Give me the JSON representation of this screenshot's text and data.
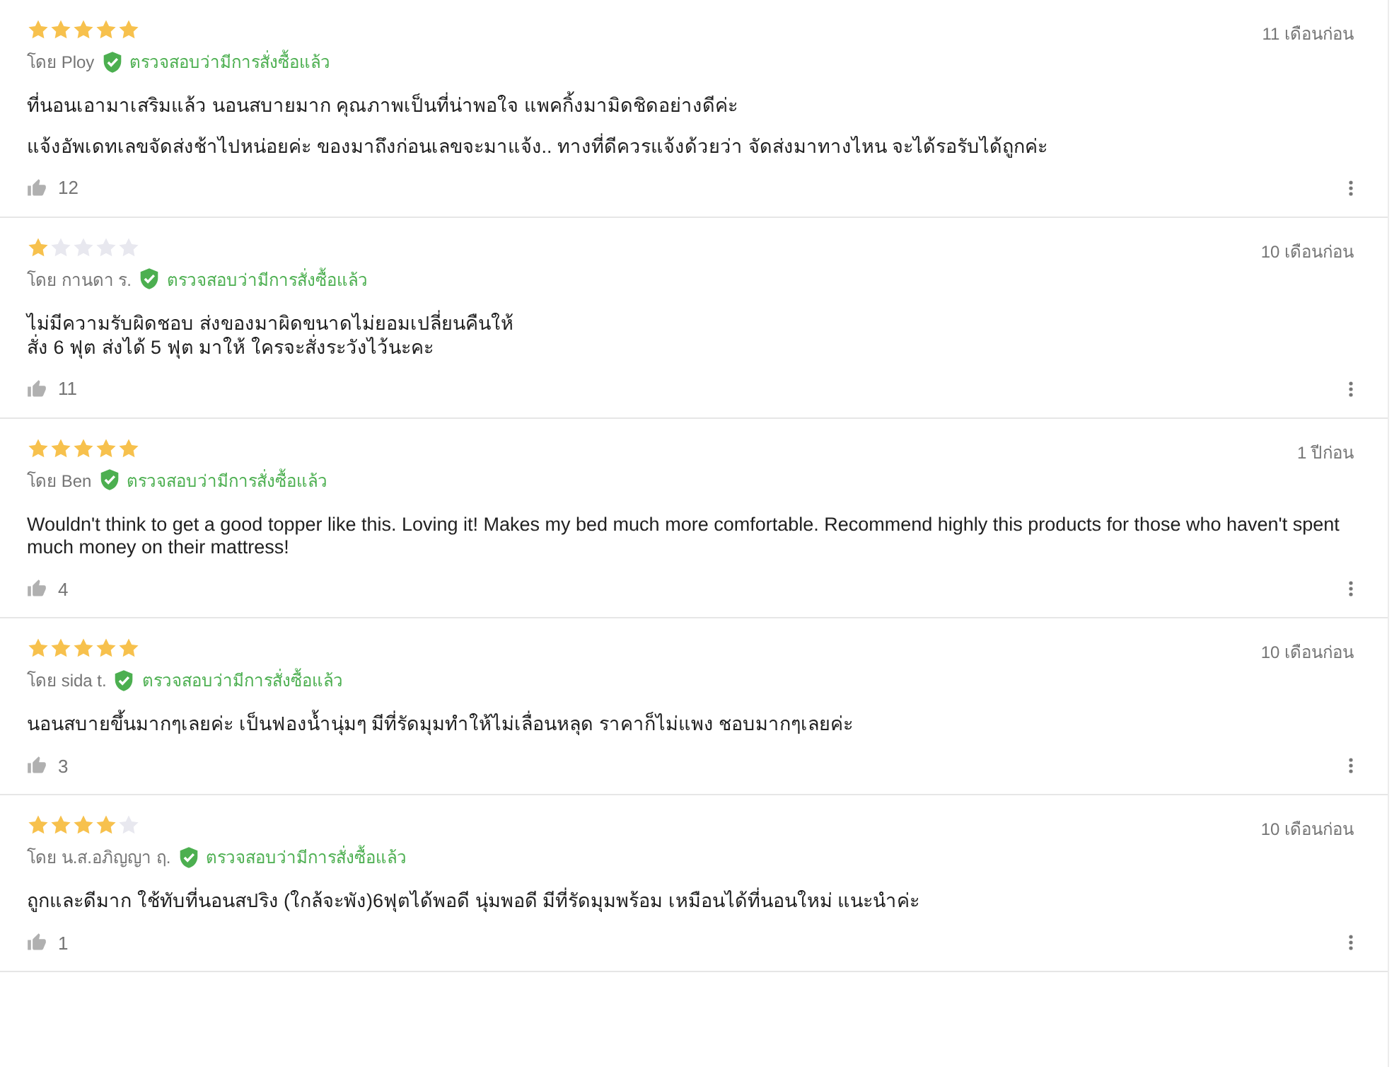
{
  "reviews": [
    {
      "stars": 5,
      "author": "โดย Ploy",
      "verified": "ตรวจสอบว่ามีการสั่งซื้อแล้ว",
      "date": "11 เดือนก่อน",
      "paragraphs": [
        "ที่นอนเอามาเสริมแล้ว นอนสบายมาก  คุณภาพเป็นที่น่าพอใจ แพคกิ้งมามิดชิดอย่างดีค่ะ",
        "แจ้งอัพเดทเลขจัดส่งช้าไปหน่อยค่ะ ของมาถึงก่อนเลขจะมาแจ้ง.. ทางที่ดีควรแจ้งด้วยว่า จัดส่งมาทางไหน จะได้รอรับได้ถูกค่ะ"
      ],
      "likes": "12"
    },
    {
      "stars": 1,
      "author": "โดย กานดา ร.",
      "verified": "ตรวจสอบว่ามีการสั่งซื้อแล้ว",
      "date": "10 เดือนก่อน",
      "paragraphs": [
        "ไม่มีความรับผิดชอบ ส่งของมาผิดขนาดไม่ยอมเปลี่ยนคืนให้\nสั่ง 6 ฟุต ส่งได้ 5 ฟุต มาให้ ใครจะสั่งระวังไว้นะคะ"
      ],
      "likes": "11"
    },
    {
      "stars": 5,
      "author": "โดย Ben",
      "verified": "ตรวจสอบว่ามีการสั่งซื้อแล้ว",
      "date": "1 ปีก่อน",
      "paragraphs": [
        "Wouldn't think to get a good topper like this. Loving it! Makes my bed much more comfortable. Recommend highly this products for those who haven't spent much money on their mattress!"
      ],
      "likes": "4"
    },
    {
      "stars": 5,
      "author": "โดย sida t.",
      "verified": "ตรวจสอบว่ามีการสั่งซื้อแล้ว",
      "date": "10 เดือนก่อน",
      "paragraphs": [
        "นอนสบายขึ้นมากๆเลยค่ะ เป็นฟองน้ำนุ่มๆ มีที่รัดมุมทำให้ไม่เลื่อนหลุด  ราคาก็ไม่แพง  ชอบมากๆเลยค่ะ"
      ],
      "likes": "3"
    },
    {
      "stars": 4,
      "author": "โดย น.ส.อภิญญา ฤ.",
      "verified": "ตรวจสอบว่ามีการสั่งซื้อแล้ว",
      "date": "10 เดือนก่อน",
      "paragraphs": [
        "ถูกและดีมาก ใช้ทับที่นอนสปริง (ใกล้จะพัง)6ฟุตได้พอดี นุ่มพอดี มีที่รัดมุมพร้อม เหมือนได้ที่นอนใหม่ แนะนำค่ะ"
      ],
      "likes": "1"
    }
  ]
}
